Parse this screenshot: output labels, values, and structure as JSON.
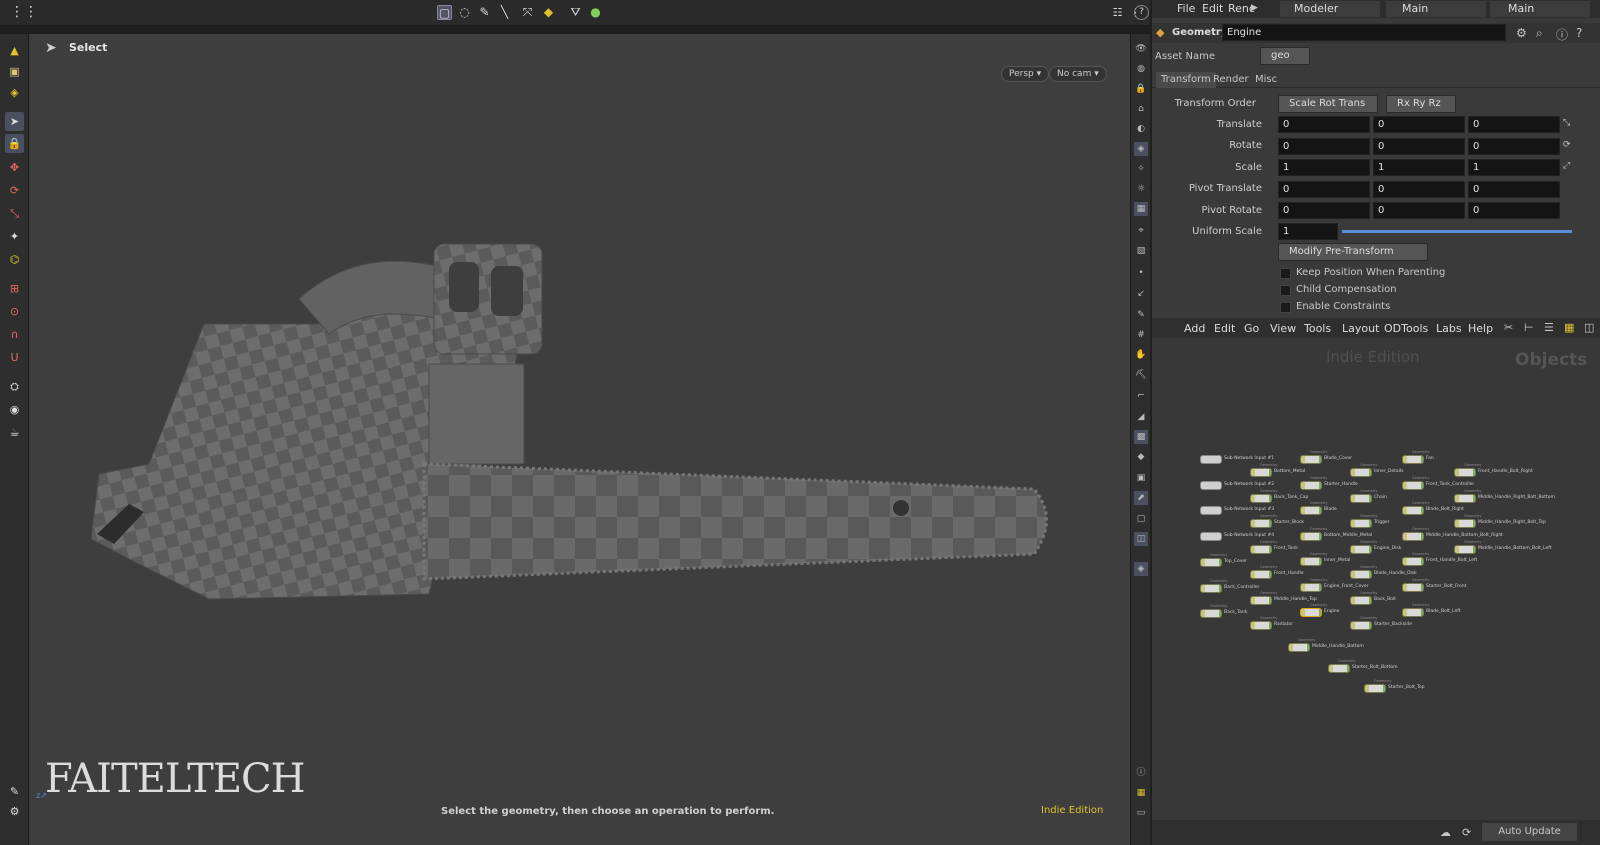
{
  "viewport": {
    "tool_title": "Select",
    "persp_label": "Persp",
    "cam_label": "No cam",
    "status_message": "Select the geometry, then choose an operation to perform.",
    "edition_badge": "Indie Edition",
    "logo_text": "FAITELTECH"
  },
  "menubar": {
    "file": "File",
    "edit": "Edit",
    "render": "Renc",
    "desktop": "Modeler",
    "pane_tab": "Main",
    "network_tab": "Main"
  },
  "parameters": {
    "type_label": "Geometry",
    "node_name": "Engine",
    "asset_name_label": "Asset Name",
    "asset_name_value": "geo",
    "tabs": [
      "Transform",
      "Render",
      "Misc"
    ],
    "transform_order_label": "Transform Order",
    "transform_order_value": "Scale Rot Trans",
    "rotate_order_value": "Rx Ry Rz",
    "rows": [
      {
        "label": "Translate",
        "x": "0",
        "y": "0",
        "z": "0"
      },
      {
        "label": "Rotate",
        "x": "0",
        "y": "0",
        "z": "0"
      },
      {
        "label": "Scale",
        "x": "1",
        "y": "1",
        "z": "1"
      },
      {
        "label": "Pivot Translate",
        "x": "0",
        "y": "0",
        "z": "0"
      },
      {
        "label": "Pivot Rotate",
        "x": "0",
        "y": "0",
        "z": "0"
      }
    ],
    "uniform_scale_label": "Uniform Scale",
    "uniform_scale_value": "1",
    "modify_menu": "Modify Pre-Transform",
    "checkboxes": [
      "Keep Position When Parenting",
      "Child Compensation",
      "Enable Constraints"
    ]
  },
  "network": {
    "menu": [
      "Add",
      "Edit",
      "Go",
      "View",
      "Tools",
      "Layout",
      "ODTools",
      "Labs",
      "Help"
    ],
    "watermark": "Indie Edition",
    "context_label": "Objects",
    "auto_update": "Auto Update",
    "node_caption": "Geometry",
    "nodes": [
      "Sub-Network Input #1",
      "Sub-Network Input #2",
      "Sub-Network Input #3",
      "Sub-Network Input #4",
      "Top_Cover",
      "Back_Controller",
      "Back_Tank",
      "Bottom_Metal",
      "Back_Tank_Cap",
      "Starter_Block",
      "Front_Tank",
      "Front_Handle",
      "Middle_Handle_Top",
      "Radiator",
      "Blade_Cover",
      "Starter_Handle",
      "Blade",
      "Bottom_Middle_Metal",
      "Inner_Metal",
      "Engine_Front_Cover",
      "Engine",
      "Middle_Handle_Bottom",
      "Starter_Bolt_Bottom",
      "Starter_Bolt_Top",
      "Inner_Details",
      "Chain",
      "Trigger",
      "Engine_Disk",
      "Blade_Handle_Disk",
      "Back_Bolt",
      "Starter_Backside",
      "Fan",
      "Front_Tank_Controller",
      "Blade_Bolt_Right",
      "Middle_Handle_Bottom_Bolt_Right",
      "Front_Handle_Bolt_Left",
      "Starter_Bolt_Front",
      "Blade_Bolt_Left",
      "Front_Handle_Bolt_Right",
      "Middle_Handle_Right_Bolt_Bottom",
      "Middle_Handle_Right_Bolt_Top",
      "Middle_Handle_Bottom_Bolt_Left"
    ]
  },
  "colors": {
    "accent": "#e0c22e",
    "selection": "#e6a800"
  },
  "icons": [
    "grid-menu-icon",
    "box-select-icon",
    "lasso-icon",
    "brush-icon",
    "arrow-icon",
    "shield-icon",
    "gear-icon",
    "help-icon"
  ]
}
